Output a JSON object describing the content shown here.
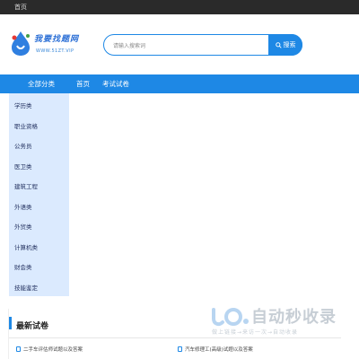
{
  "topbar": {
    "home_link": "首页"
  },
  "logo": {
    "cn": "我要找题网",
    "en": "WWW.51ZT.VIP"
  },
  "search": {
    "placeholder": "请输入搜索词",
    "button_label": "搜索"
  },
  "nav": {
    "all_categories": "全部分类",
    "home": "首页",
    "exams": "考试试卷"
  },
  "sidebar": {
    "items": [
      {
        "label": "学历类"
      },
      {
        "label": "职业资格"
      },
      {
        "label": "公务员"
      },
      {
        "label": "医卫类"
      },
      {
        "label": "建筑工程"
      },
      {
        "label": "外语类"
      },
      {
        "label": "外贸类"
      },
      {
        "label": "计算机类"
      },
      {
        "label": "财会类"
      },
      {
        "label": "技能鉴定"
      }
    ]
  },
  "latest": {
    "title": "最新试卷",
    "items": [
      {
        "label": "二手车评估师试题以及答案"
      },
      {
        "label": "汽车修理工(高级)试题以及答案"
      }
    ]
  },
  "watermark": {
    "brand": "自动秒收录",
    "sub": "做上链接→来访一次→自动收录"
  },
  "colors": {
    "accent": "#1e88e5",
    "sidebar_bg": "#dbeafe",
    "topbar_bg": "#2a2a2a"
  }
}
